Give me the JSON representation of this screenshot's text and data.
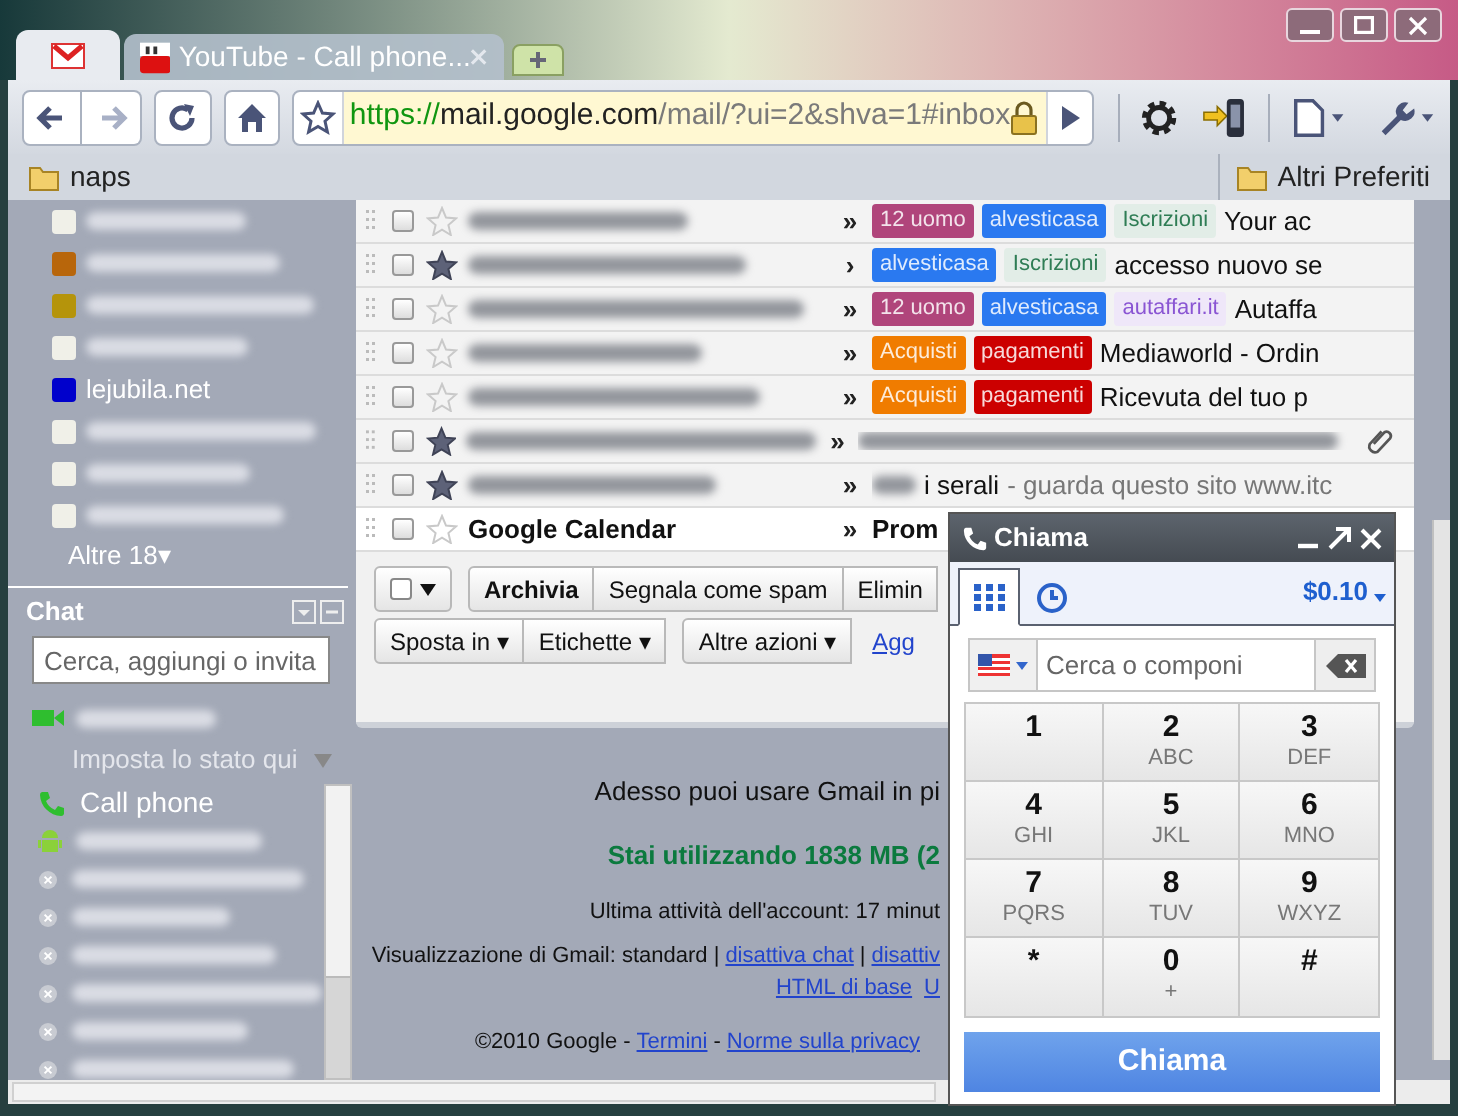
{
  "browser": {
    "tabs": [
      {
        "kind": "gmail",
        "selected": true
      },
      {
        "kind": "youtube",
        "title": "YouTube - Call phone...",
        "selected": false
      }
    ],
    "nav": [
      {
        "kind": "back",
        "disabled": false
      },
      {
        "kind": "forward",
        "disabled": true
      }
    ],
    "address": {
      "scheme": "https://",
      "host": "mail.google.com",
      "path": "/mail/?ui=2&shva=1#inbox",
      "secure": true
    },
    "bookmarks": [
      {
        "label": "naps"
      }
    ],
    "other_bookmarks": "Altri Preferiti"
  },
  "sidebar": {
    "labels": [
      {
        "color": "#f0f0e8"
      },
      {
        "color": "#b8660b"
      },
      {
        "color": "#b5940b"
      },
      {
        "color": "#f0f0e8"
      },
      {
        "color": "#0000cc",
        "name": "lejubila.net"
      },
      {
        "color": "#f0f0e8"
      },
      {
        "color": "#f0f0e8"
      },
      {
        "color": "#f0f0e8"
      }
    ],
    "more": "Altre 18▾"
  },
  "chat": {
    "title": "Chat",
    "search": {
      "placeholder": "Cerca, aggiungi o invita"
    },
    "status": "Imposta lo stato qui",
    "contacts": [
      {
        "kind": "phone",
        "name": "Call phone"
      },
      {
        "kind": "android"
      },
      {
        "kind": "offline"
      },
      {
        "kind": "offline"
      },
      {
        "kind": "offline"
      },
      {
        "kind": "offline"
      },
      {
        "kind": "offline"
      },
      {
        "kind": "offline"
      }
    ]
  },
  "messages": [
    {
      "checked": false,
      "starred": false,
      "unread": false,
      "marker": "»",
      "labels": [
        {
          "kind": "solid",
          "text": "12 uomo",
          "color": "#b0457b"
        },
        {
          "kind": "solid",
          "text": "alvesticasa",
          "color": "#2a79f0"
        },
        {
          "kind": "light",
          "text": "Iscrizioni",
          "color": "#2f7d55"
        }
      ],
      "subject": "Your ac"
    },
    {
      "checked": false,
      "starred": true,
      "unread": false,
      "marker": "›",
      "labels": [
        {
          "kind": "solid",
          "text": "alvesticasa",
          "color": "#2a79f0"
        },
        {
          "kind": "light",
          "text": "Iscrizioni",
          "color": "#2f7d55"
        }
      ],
      "subject": "accesso nuovo se"
    },
    {
      "checked": false,
      "starred": false,
      "unread": false,
      "marker": "»",
      "labels": [
        {
          "kind": "solid",
          "text": "12 uomo",
          "color": "#b0457b"
        },
        {
          "kind": "solid",
          "text": "alvesticasa",
          "color": "#2a79f0"
        },
        {
          "kind": "light",
          "text": "autaffari.it",
          "color": "#8a55d3"
        }
      ],
      "subject": "Autaffa"
    },
    {
      "checked": false,
      "starred": false,
      "unread": false,
      "marker": "»",
      "labels": [
        {
          "kind": "solid",
          "text": "Acquisti",
          "color": "#f07c00"
        },
        {
          "kind": "solid",
          "text": "pagamenti",
          "color": "#cc0000"
        }
      ],
      "subject": "Mediaworld - Ordin"
    },
    {
      "checked": false,
      "starred": false,
      "unread": false,
      "marker": "»",
      "labels": [
        {
          "kind": "solid",
          "text": "Acquisti",
          "color": "#f07c00"
        },
        {
          "kind": "solid",
          "text": "pagamenti",
          "color": "#cc0000"
        }
      ],
      "subject": "Ricevuta del tuo p"
    },
    {
      "checked": false,
      "starred": true,
      "unread": false,
      "marker": "»",
      "attachment": true
    },
    {
      "checked": false,
      "starred": true,
      "unread": false,
      "marker": "»",
      "subject": "i serali",
      "snippet": "- guarda questo sito www.itc"
    },
    {
      "checked": false,
      "starred": false,
      "unread": true,
      "marker": "»",
      "sender": "Google Calendar",
      "subject": "Prom"
    }
  ],
  "toolbar": {
    "actions": [
      {
        "kind": "primary",
        "text": "Archivia"
      },
      {
        "kind": "plain",
        "text": "Segnala come spam"
      },
      {
        "kind": "plain",
        "text": "Elimin"
      }
    ],
    "menus": [
      {
        "text": "Sposta in ▾"
      },
      {
        "text": "Etichette ▾"
      },
      {
        "text": "Altre azioni ▾"
      }
    ],
    "link": "Agg"
  },
  "footer": {
    "notice": "Adesso puoi usare Gmail in pi",
    "usage": "Stai utilizzando 1838 MB (2",
    "activity": "Ultima attività dell'account: 17 minut",
    "view_text": "Visualizzazione di Gmail: standard |",
    "view_links": [
      "disattiva chat",
      "disattiv"
    ],
    "view_separator": "|",
    "base_links": [
      "HTML di base",
      "U"
    ],
    "copyright": "©2010 Google -",
    "legal_links": [
      "Termini",
      "Norme sulla privacy"
    ],
    "legal_separator": "-"
  },
  "dialer": {
    "title": "Chiama",
    "tabs": [
      {
        "kind": "keypad",
        "selected": true
      },
      {
        "kind": "history",
        "selected": false
      }
    ],
    "credit": "$0.10",
    "search": {
      "placeholder": "Cerca o componi"
    },
    "keys": [
      {
        "digit": "1"
      },
      {
        "digit": "2",
        "letters": "ABC"
      },
      {
        "digit": "3",
        "letters": "DEF"
      },
      {
        "digit": "4",
        "letters": "GHI"
      },
      {
        "digit": "5",
        "letters": "JKL"
      },
      {
        "digit": "6",
        "letters": "MNO"
      },
      {
        "digit": "7",
        "letters": "PQRS"
      },
      {
        "digit": "8",
        "letters": "TUV"
      },
      {
        "digit": "9",
        "letters": "WXYZ"
      },
      {
        "digit": "*"
      },
      {
        "digit": "0",
        "letters": "+"
      },
      {
        "digit": "#"
      }
    ],
    "call_button": "Chiama"
  }
}
